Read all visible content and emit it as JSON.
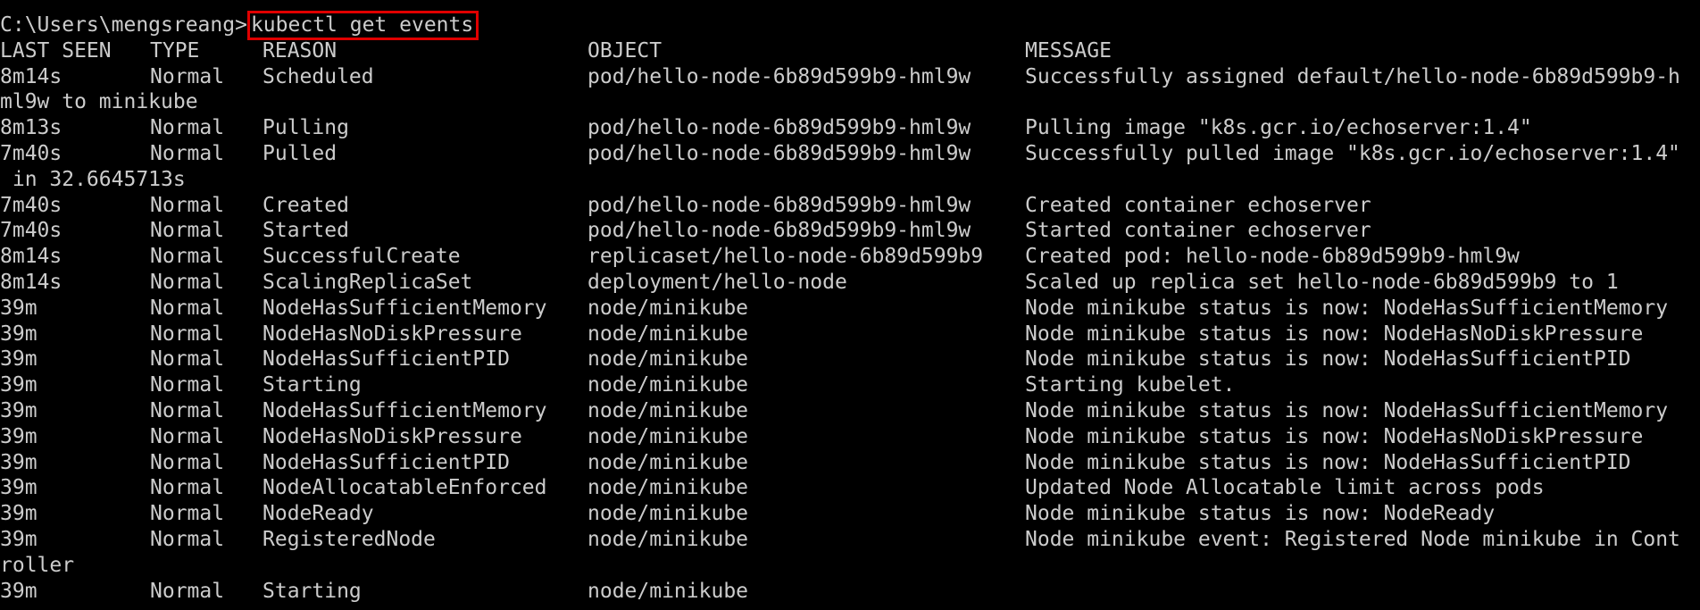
{
  "prompt": "C:\\Users\\mengsreang>",
  "command": "kubectl get events",
  "highlight_color": "#e00000",
  "headers": [
    "LAST SEEN",
    "TYPE",
    "REASON",
    "OBJECT",
    "MESSAGE"
  ],
  "rows": [
    {
      "last_seen": "8m14s",
      "type": "Normal",
      "reason": "Scheduled",
      "object": "pod/hello-node-6b89d599b9-hml9w",
      "message": "Successfully assigned default/hello-node-6b89d599b9-h",
      "wrap": "ml9w to minikube"
    },
    {
      "last_seen": "8m13s",
      "type": "Normal",
      "reason": "Pulling",
      "object": "pod/hello-node-6b89d599b9-hml9w",
      "message": "Pulling image \"k8s.gcr.io/echoserver:1.4\"",
      "wrap": ""
    },
    {
      "last_seen": "7m40s",
      "type": "Normal",
      "reason": "Pulled",
      "object": "pod/hello-node-6b89d599b9-hml9w",
      "message": "Successfully pulled image \"k8s.gcr.io/echoserver:1.4\"",
      "wrap": " in 32.6645713s"
    },
    {
      "last_seen": "7m40s",
      "type": "Normal",
      "reason": "Created",
      "object": "pod/hello-node-6b89d599b9-hml9w",
      "message": "Created container echoserver",
      "wrap": ""
    },
    {
      "last_seen": "7m40s",
      "type": "Normal",
      "reason": "Started",
      "object": "pod/hello-node-6b89d599b9-hml9w",
      "message": "Started container echoserver",
      "wrap": ""
    },
    {
      "last_seen": "8m14s",
      "type": "Normal",
      "reason": "SuccessfulCreate",
      "object": "replicaset/hello-node-6b89d599b9",
      "message": "Created pod: hello-node-6b89d599b9-hml9w",
      "wrap": ""
    },
    {
      "last_seen": "8m14s",
      "type": "Normal",
      "reason": "ScalingReplicaSet",
      "object": "deployment/hello-node",
      "message": "Scaled up replica set hello-node-6b89d599b9 to 1",
      "wrap": ""
    },
    {
      "last_seen": "39m",
      "type": "Normal",
      "reason": "NodeHasSufficientMemory",
      "object": "node/minikube",
      "message": "Node minikube status is now: NodeHasSufficientMemory",
      "wrap": ""
    },
    {
      "last_seen": "39m",
      "type": "Normal",
      "reason": "NodeHasNoDiskPressure",
      "object": "node/minikube",
      "message": "Node minikube status is now: NodeHasNoDiskPressure",
      "wrap": ""
    },
    {
      "last_seen": "39m",
      "type": "Normal",
      "reason": "NodeHasSufficientPID",
      "object": "node/minikube",
      "message": "Node minikube status is now: NodeHasSufficientPID",
      "wrap": ""
    },
    {
      "last_seen": "39m",
      "type": "Normal",
      "reason": "Starting",
      "object": "node/minikube",
      "message": "Starting kubelet.",
      "wrap": ""
    },
    {
      "last_seen": "39m",
      "type": "Normal",
      "reason": "NodeHasSufficientMemory",
      "object": "node/minikube",
      "message": "Node minikube status is now: NodeHasSufficientMemory",
      "wrap": ""
    },
    {
      "last_seen": "39m",
      "type": "Normal",
      "reason": "NodeHasNoDiskPressure",
      "object": "node/minikube",
      "message": "Node minikube status is now: NodeHasNoDiskPressure",
      "wrap": ""
    },
    {
      "last_seen": "39m",
      "type": "Normal",
      "reason": "NodeHasSufficientPID",
      "object": "node/minikube",
      "message": "Node minikube status is now: NodeHasSufficientPID",
      "wrap": ""
    },
    {
      "last_seen": "39m",
      "type": "Normal",
      "reason": "NodeAllocatableEnforced",
      "object": "node/minikube",
      "message": "Updated Node Allocatable limit across pods",
      "wrap": ""
    },
    {
      "last_seen": "39m",
      "type": "Normal",
      "reason": "NodeReady",
      "object": "node/minikube",
      "message": "Node minikube status is now: NodeReady",
      "wrap": ""
    },
    {
      "last_seen": "39m",
      "type": "Normal",
      "reason": "RegisteredNode",
      "object": "node/minikube",
      "message": "Node minikube event: Registered Node minikube in Cont",
      "wrap": "roller"
    },
    {
      "last_seen": "39m",
      "type": "Normal",
      "reason": "Starting",
      "object": "node/minikube",
      "message": "",
      "wrap": ""
    }
  ]
}
